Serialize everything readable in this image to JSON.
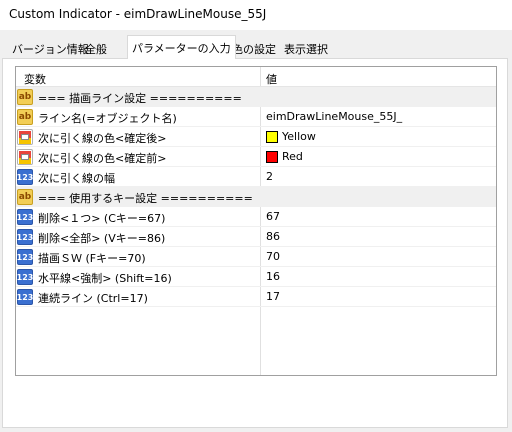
{
  "window": {
    "title": "Custom Indicator - eimDrawLineMouse_55J"
  },
  "tabs": [
    {
      "label": "バージョン情報"
    },
    {
      "label": "全般"
    },
    {
      "label": "パラメーターの入力",
      "active": true
    },
    {
      "label": "色の設定"
    },
    {
      "label": "表示選択"
    }
  ],
  "grid": {
    "headers": {
      "name": "変数",
      "value": "値"
    },
    "rows": [
      {
        "icon": "text-icon",
        "name": "=== 描画ライン設定 ==========",
        "value": "",
        "section": true
      },
      {
        "icon": "text-icon",
        "name": "ライン名(=オブジェクト名)",
        "value": "eimDrawLineMouse_55J_"
      },
      {
        "icon": "color-icon",
        "name": "次に引く線の色<確定後>",
        "value": "Yellow",
        "swatch": "#ffff00"
      },
      {
        "icon": "color-icon",
        "name": "次に引く線の色<確定前>",
        "value": "Red",
        "swatch": "#ff0000"
      },
      {
        "icon": "number-icon",
        "name": "次に引く線の幅",
        "value": "2"
      },
      {
        "icon": "text-icon",
        "name": "=== 使用するキー設定 ==========",
        "value": "",
        "section": true
      },
      {
        "icon": "number-icon",
        "name": "削除<１つ> (Cキー=67)",
        "value": "67"
      },
      {
        "icon": "number-icon",
        "name": "削除<全部> (Vキー=86)",
        "value": "86"
      },
      {
        "icon": "number-icon",
        "name": "描画ＳＷ (Fキー=70)",
        "value": "70"
      },
      {
        "icon": "number-icon",
        "name": "水平線<強制> (Shift=16)",
        "value": "16"
      },
      {
        "icon": "number-icon",
        "name": "連続ライン (Ctrl=17)",
        "value": "17"
      }
    ]
  }
}
